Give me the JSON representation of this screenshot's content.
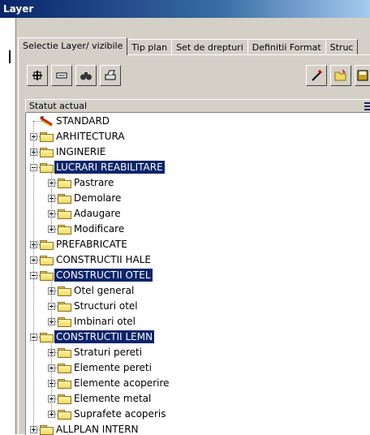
{
  "window": {
    "title": "Layer"
  },
  "tabs": [
    "Selectie Layer/ vizibile",
    "Tip plan",
    "Set de drepturi",
    "Definitii Format",
    "Struc"
  ],
  "toolbar": {
    "left_icons": [
      "add-layer-icon",
      "remove-layer-icon",
      "find-icon",
      "print-icon"
    ],
    "right_icons": [
      "pick-layer-icon",
      "open-folder-icon",
      "save-icon"
    ]
  },
  "list_header": {
    "label": "Statut actual",
    "icon": "list-view-icon"
  },
  "tree": [
    {
      "label": "STANDARD",
      "level": 0,
      "icon": "standard-icon",
      "expandable": false,
      "selected": false
    },
    {
      "label": "ARHITECTURA",
      "level": 0,
      "icon": "folder-icon",
      "expandable": true,
      "expanded": false,
      "selected": false
    },
    {
      "label": "INGINERIE",
      "level": 0,
      "icon": "folder-icon",
      "expandable": true,
      "expanded": false,
      "selected": false
    },
    {
      "label": "LUCRARI REABILITARE",
      "level": 0,
      "icon": "folder-icon",
      "expandable": true,
      "expanded": true,
      "selected": true
    },
    {
      "label": "Pastrare",
      "level": 1,
      "icon": "folder-icon",
      "expandable": true,
      "expanded": false,
      "selected": false
    },
    {
      "label": "Demolare",
      "level": 1,
      "icon": "folder-icon",
      "expandable": true,
      "expanded": false,
      "selected": false
    },
    {
      "label": "Adaugare",
      "level": 1,
      "icon": "folder-icon",
      "expandable": true,
      "expanded": false,
      "selected": false
    },
    {
      "label": "Modificare",
      "level": 1,
      "icon": "folder-icon",
      "expandable": true,
      "expanded": false,
      "selected": false
    },
    {
      "label": "PREFABRICATE",
      "level": 0,
      "icon": "folder-icon",
      "expandable": true,
      "expanded": false,
      "selected": false
    },
    {
      "label": "CONSTRUCTII HALE",
      "level": 0,
      "icon": "folder-icon",
      "expandable": true,
      "expanded": false,
      "selected": false
    },
    {
      "label": "CONSTRUCTII OTEL",
      "level": 0,
      "icon": "folder-icon",
      "expandable": true,
      "expanded": true,
      "selected": true
    },
    {
      "label": "Otel general",
      "level": 1,
      "icon": "folder-icon",
      "expandable": true,
      "expanded": false,
      "selected": false
    },
    {
      "label": "Structuri otel",
      "level": 1,
      "icon": "folder-icon",
      "expandable": true,
      "expanded": false,
      "selected": false
    },
    {
      "label": "Imbinari otel",
      "level": 1,
      "icon": "folder-icon",
      "expandable": true,
      "expanded": false,
      "selected": false
    },
    {
      "label": "CONSTRUCTII LEMN",
      "level": 0,
      "icon": "folder-icon",
      "expandable": true,
      "expanded": true,
      "selected": true
    },
    {
      "label": "Straturi pereti",
      "level": 1,
      "icon": "folder-icon",
      "expandable": true,
      "expanded": false,
      "selected": false
    },
    {
      "label": "Elemente pereti",
      "level": 1,
      "icon": "folder-icon",
      "expandable": true,
      "expanded": false,
      "selected": false
    },
    {
      "label": "Elemente acoperire",
      "level": 1,
      "icon": "folder-icon",
      "expandable": true,
      "expanded": false,
      "selected": false
    },
    {
      "label": "Elemente metal",
      "level": 1,
      "icon": "folder-icon",
      "expandable": true,
      "expanded": false,
      "selected": false
    },
    {
      "label": "Suprafete acoperis",
      "level": 1,
      "icon": "folder-icon",
      "expandable": true,
      "expanded": false,
      "selected": false
    },
    {
      "label": "ALLPLAN INTERN",
      "level": 0,
      "icon": "folder-icon",
      "expandable": true,
      "expanded": false,
      "selected": false
    }
  ],
  "colors": {
    "titlebar": "#0a246a",
    "selection": "#0a246a",
    "face": "#d4d0c8",
    "folder": "#f0d860"
  }
}
